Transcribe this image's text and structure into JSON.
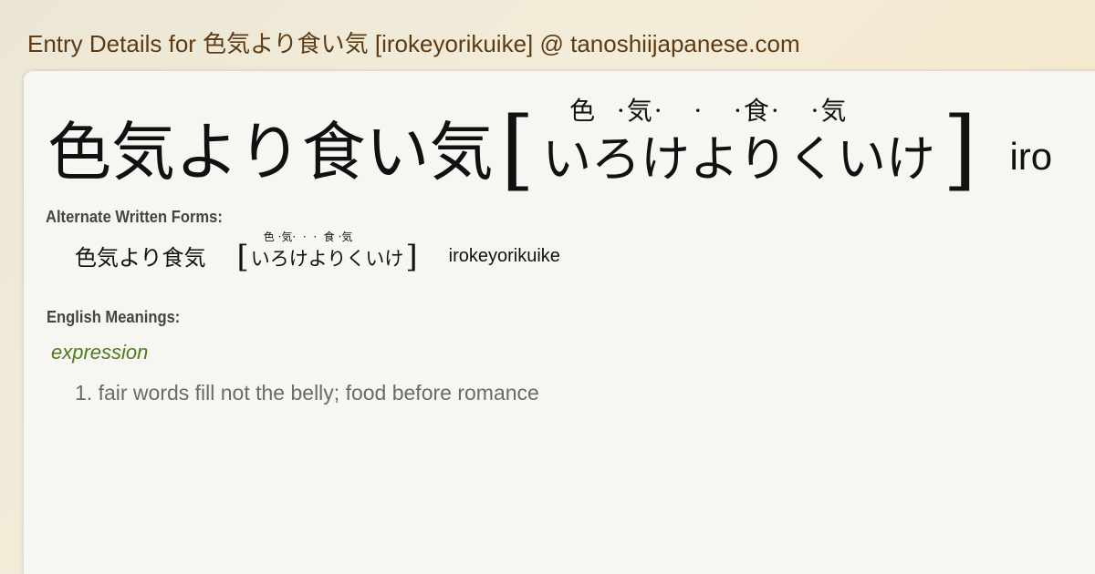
{
  "page": {
    "title": "Entry Details for 色気より食い気 [irokeyorikuike] @ tanoshiijapanese.com"
  },
  "entry": {
    "headword": "色気より食い気",
    "reading": "いろけよりくいけ",
    "furigana": "色  ·気·   ·   ·食·   ·気",
    "romaji": "iro"
  },
  "alternate_forms": {
    "label": "Alternate Written Forms:",
    "items": [
      {
        "kanji": "色気より食気",
        "reading": "いろけよりくいけ",
        "furigana": "色 ·気·  ·  ·  食 ·気",
        "romaji": "irokeyorikuike"
      }
    ]
  },
  "english_meanings": {
    "label": "English Meanings:",
    "part_of_speech": "expression",
    "definitions": [
      "1. fair words fill not the belly; food before romance"
    ]
  },
  "colors": {
    "title": "#5e3a13",
    "part_of_speech": "#4f7a1f",
    "meaning": "#6a6a6a",
    "panel": "#f7f6f2"
  }
}
